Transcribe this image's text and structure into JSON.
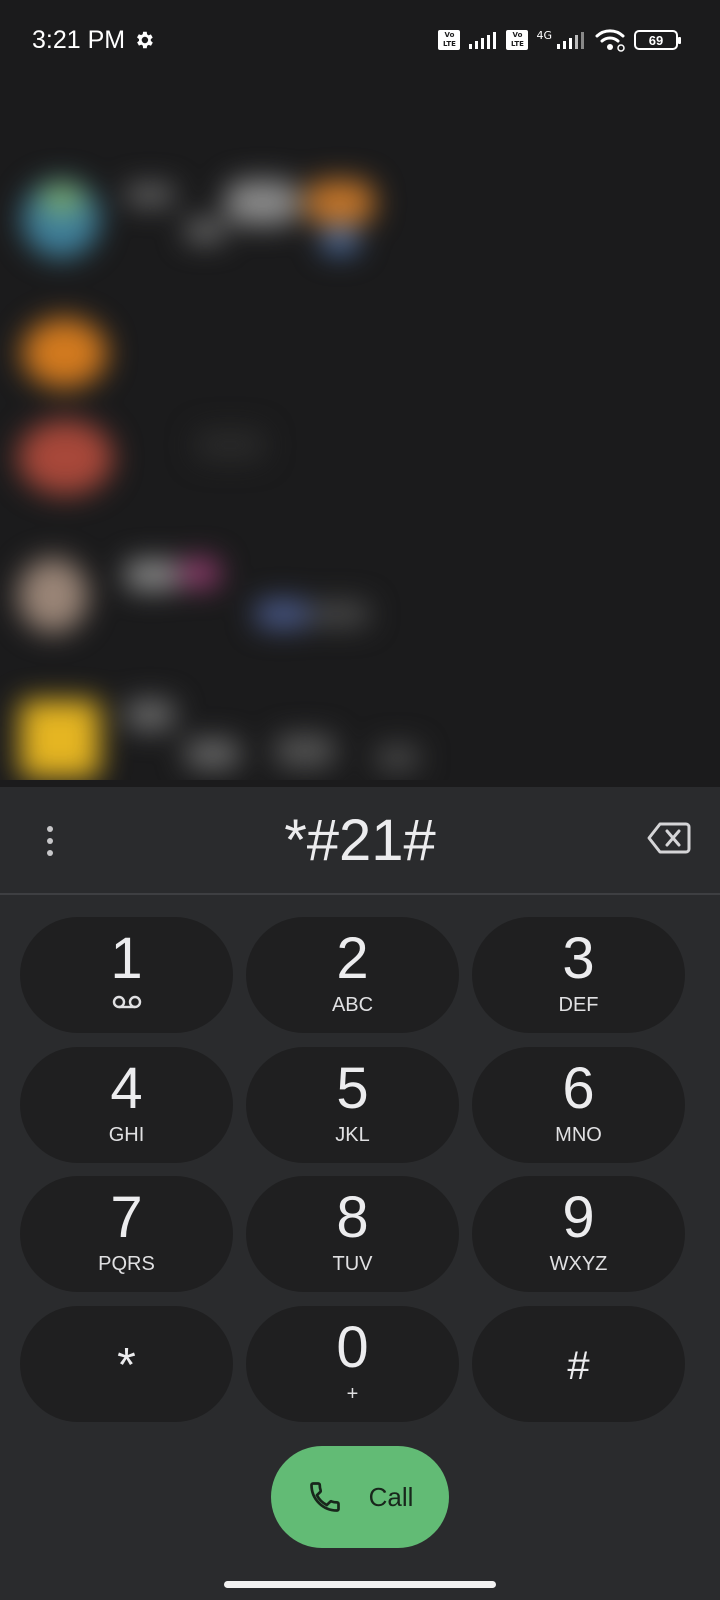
{
  "status_bar": {
    "time": "3:21 PM",
    "volte_1": "Vo LTE",
    "volte_2": "Vo LTE",
    "network": "4G",
    "battery": "69"
  },
  "dialer": {
    "entered_digits": "*#21#"
  },
  "keypad": [
    {
      "digit": "1",
      "letters": "",
      "icon": "voicemail-icon"
    },
    {
      "digit": "2",
      "letters": "ABC"
    },
    {
      "digit": "3",
      "letters": "DEF"
    },
    {
      "digit": "4",
      "letters": "GHI"
    },
    {
      "digit": "5",
      "letters": "JKL"
    },
    {
      "digit": "6",
      "letters": "MNO"
    },
    {
      "digit": "7",
      "letters": "PQRS"
    },
    {
      "digit": "8",
      "letters": "TUV"
    },
    {
      "digit": "9",
      "letters": "WXYZ"
    },
    {
      "digit": "*",
      "letters": ""
    },
    {
      "digit": "0",
      "letters": "+"
    },
    {
      "digit": "#",
      "letters": ""
    }
  ],
  "call_button": {
    "label": "Call",
    "color": "#62bb75"
  }
}
